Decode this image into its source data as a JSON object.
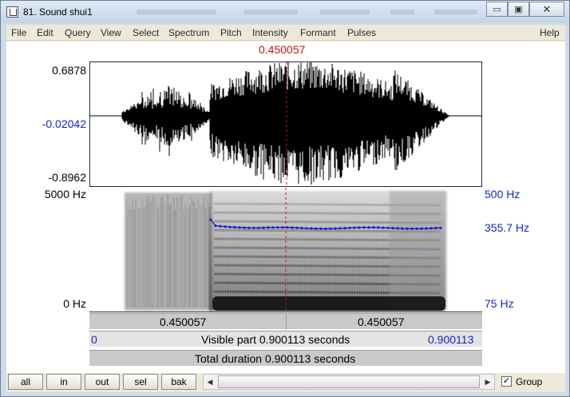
{
  "window": {
    "title": "81. Sound shui1",
    "minimize_glyph": "▭",
    "maximize_glyph": "▣",
    "close_glyph": "✕"
  },
  "menu": [
    "File",
    "Edit",
    "Query",
    "View",
    "Select",
    "Spectrum",
    "Pitch",
    "Intensity",
    "Formant",
    "Pulses"
  ],
  "help": "Help",
  "cursor_time": "0.450057",
  "waveform": {
    "top": "0.6878",
    "middle": "-0.02042",
    "bottom": "-0.8962"
  },
  "spectrogram": {
    "left_top": "5000 Hz",
    "left_bottom": "0 Hz",
    "right_top": "500 Hz",
    "right_mid": "355.7 Hz",
    "right_bottom": "75 Hz"
  },
  "time_row": {
    "left": "0.450057",
    "right": "0.450057"
  },
  "visible_row": {
    "start": "0",
    "label": "Visible part 0.900113 seconds",
    "end": "0.900113"
  },
  "total_row": {
    "label": "Total duration 0.900113 seconds"
  },
  "buttons": [
    "all",
    "in",
    "out",
    "sel",
    "bak"
  ],
  "group": {
    "label": "Group",
    "checked": true,
    "check_glyph": "✓"
  },
  "scroll_arrows": {
    "left": "◀",
    "right": "▶"
  },
  "colors": {
    "cursor": "#d01010",
    "pitch": "#1a22cc"
  }
}
